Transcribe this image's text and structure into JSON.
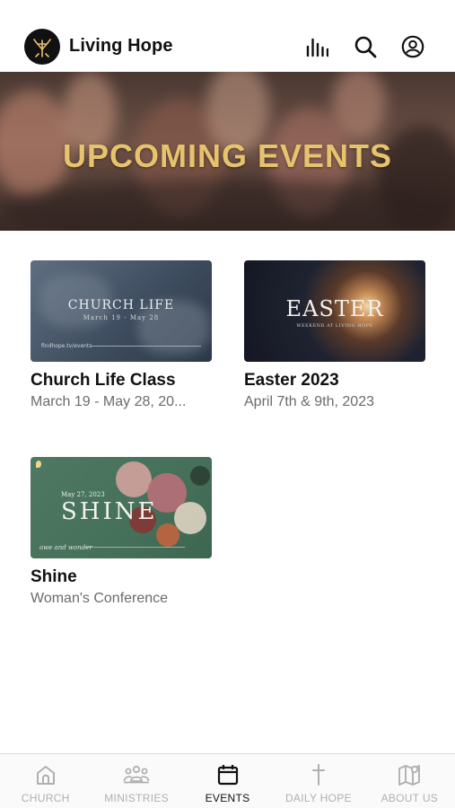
{
  "header": {
    "app_name": "Living Hope",
    "logo_icon": "tree-cross-logo",
    "icons": [
      "equalizer-icon",
      "search-icon",
      "account-icon"
    ]
  },
  "hero": {
    "title": "UPCOMING EVENTS"
  },
  "events": [
    {
      "title": "Church Life Class",
      "subtitle": "March 19 - May 28, 20...",
      "thumb_title": "CHURCH LIFE",
      "thumb_dates": "March 19 - May 28",
      "thumb_footer": "findhope.tv/events"
    },
    {
      "title": "Easter 2023",
      "subtitle": "April 7th & 9th, 2023",
      "thumb_title": "EASTER",
      "thumb_caption": "WEEKEND AT LIVING HOPE"
    },
    {
      "title": "Shine",
      "subtitle": "Woman's Conference",
      "thumb_title": "SHINE",
      "thumb_date": "May 27, 2023",
      "thumb_tagline": "awe and wonder"
    }
  ],
  "tabs": [
    {
      "label": "CHURCH",
      "icon": "church-icon",
      "active": false
    },
    {
      "label": "MINISTRIES",
      "icon": "people-icon",
      "active": false
    },
    {
      "label": "EVENTS",
      "icon": "calendar-icon",
      "active": true
    },
    {
      "label": "DAILY HOPE",
      "icon": "cross-icon",
      "active": false
    },
    {
      "label": "ABOUT US",
      "icon": "map-icon",
      "active": false
    }
  ],
  "colors": {
    "hero_title": "#e6c36c",
    "active_tab": "#111111",
    "inactive_tab": "#b0b0b0"
  }
}
